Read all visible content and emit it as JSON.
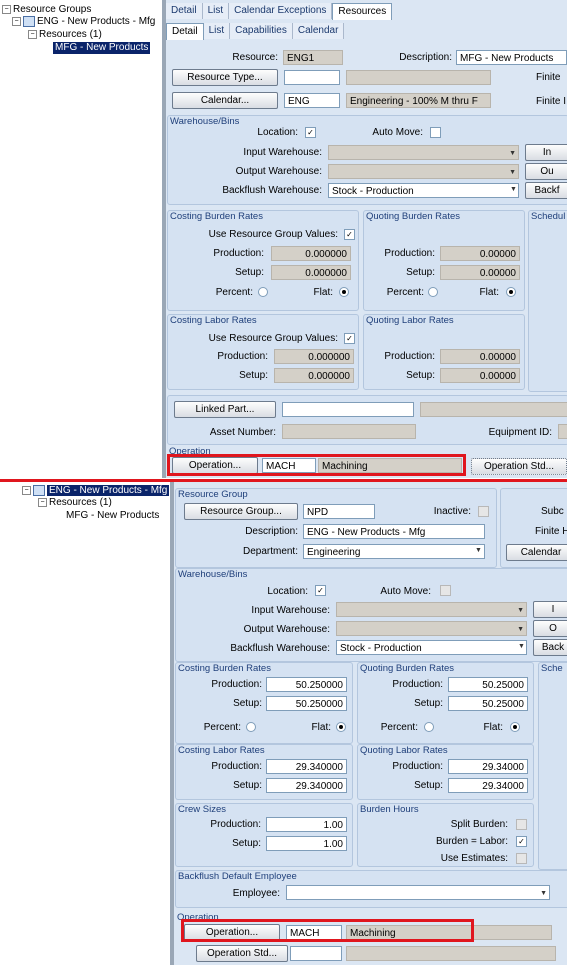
{
  "top": {
    "tree": {
      "root": "Resource Groups",
      "group": "ENG - New Products - Mfg",
      "resources": "Resources (1)",
      "resource": "MFG - New Products"
    },
    "tabs_outer": [
      "Detail",
      "List",
      "Calendar Exceptions",
      "Resources"
    ],
    "tabs_inner": [
      "Detail",
      "List",
      "Capabilities",
      "Calendar"
    ],
    "resource_label": "Resource:",
    "resource_value": "ENG1",
    "description_label": "Description:",
    "description_value": "MFG - New Products",
    "finite_label": "Finite",
    "finite2_label": "Finite I",
    "resource_type_btn": "Resource Type...",
    "calendar_btn": "Calendar...",
    "calendar_value": "ENG",
    "calendar_desc": "Engineering - 100% M thru F",
    "warehouse": {
      "title": "Warehouse/Bins",
      "location_label": "Location:",
      "location_checked": "✓",
      "auto_move_label": "Auto Move:",
      "input_label": "Input Warehouse:",
      "output_label": "Output Warehouse:",
      "backflush_label": "Backflush Warehouse:",
      "backflush_value": "Stock - Production",
      "btn1": "In",
      "btn2": "Ou",
      "btn3": "Backf"
    },
    "costing_burden": {
      "title": "Costing Burden Rates",
      "use_group_label": "Use Resource Group Values:",
      "use_group_checked": "✓",
      "production_label": "Production:",
      "production": "0.000000",
      "setup_label": "Setup:",
      "setup": "0.000000",
      "percent_label": "Percent:",
      "flat_label": "Flat:"
    },
    "quoting_burden": {
      "title": "Quoting Burden Rates",
      "production_label": "Production:",
      "production": "0.00000",
      "setup_label": "Setup:",
      "setup": "0.00000",
      "percent_label": "Percent:",
      "flat_label": "Flat:"
    },
    "schedule_title": "Schedul",
    "costing_labor": {
      "title": "Costing Labor Rates",
      "use_group_label": "Use Resource Group Values:",
      "use_group_checked": "✓",
      "production_label": "Production:",
      "production": "0.000000",
      "setup_label": "Setup:",
      "setup": "0.000000"
    },
    "quoting_labor": {
      "title": "Quoting Labor Rates",
      "production_label": "Production:",
      "production": "0.00000",
      "setup_label": "Setup:",
      "setup": "0.00000"
    },
    "linked_part_btn": "Linked Part...",
    "asset_label": "Asset Number:",
    "equipment_label": "Equipment ID:",
    "operation": {
      "title": "Operation",
      "btn": "Operation...",
      "code": "MACH",
      "desc": "Machining",
      "std_btn": "Operation Std..."
    }
  },
  "bottom": {
    "tree": {
      "group": "ENG - New Products - Mfg",
      "resources": "Resources (1)",
      "resource": "MFG - New Products"
    },
    "resource_group": {
      "title": "Resource Group",
      "btn": "Resource Group...",
      "value": "NPD",
      "inactive_label": "Inactive:",
      "description_label": "Description:",
      "description_value": "ENG - New Products - Mfg",
      "department_label": "Department:",
      "department_value": "Engineering",
      "subc_label": "Subc",
      "finite_label": "Finite H",
      "calendar_btn": "Calendar"
    },
    "warehouse": {
      "title": "Warehouse/Bins",
      "location_label": "Location:",
      "location_checked": "✓",
      "auto_move_label": "Auto Move:",
      "input_label": "Input Warehouse:",
      "output_label": "Output Warehouse:",
      "backflush_label": "Backflush Warehouse:",
      "backflush_value": "Stock - Production",
      "btn1": "I",
      "btn2": "O",
      "btn3": "Back"
    },
    "costing_burden": {
      "title": "Costing Burden Rates",
      "production_label": "Production:",
      "production": "50.250000",
      "setup_label": "Setup:",
      "setup": "50.250000",
      "percent_label": "Percent:",
      "flat_label": "Flat:"
    },
    "quoting_burden": {
      "title": "Quoting Burden Rates",
      "production_label": "Production:",
      "production": "50.25000",
      "setup_label": "Setup:",
      "setup": "50.25000",
      "percent_label": "Percent:",
      "flat_label": "Flat:"
    },
    "schedule_title": "Sche",
    "costing_labor": {
      "title": "Costing Labor Rates",
      "production_label": "Production:",
      "production": "29.340000",
      "setup_label": "Setup:",
      "setup": "29.340000"
    },
    "quoting_labor": {
      "title": "Quoting Labor Rates",
      "production_label": "Production:",
      "production": "29.34000",
      "setup_label": "Setup:",
      "setup": "29.34000"
    },
    "crew": {
      "title": "Crew Sizes",
      "production_label": "Production:",
      "production": "1.00",
      "setup_label": "Setup:",
      "setup": "1.00"
    },
    "burden_hours": {
      "title": "Burden Hours",
      "split_label": "Split Burden:",
      "equal_label": "Burden = Labor:",
      "equal_checked": "✓",
      "estimates_label": "Use Estimates:"
    },
    "backflush_emp": {
      "title": "Backflush Default Employee",
      "employee_label": "Employee:"
    },
    "operation": {
      "title": "Operation",
      "btn": "Operation...",
      "code": "MACH",
      "desc": "Machining",
      "std_btn": "Operation Std..."
    }
  }
}
